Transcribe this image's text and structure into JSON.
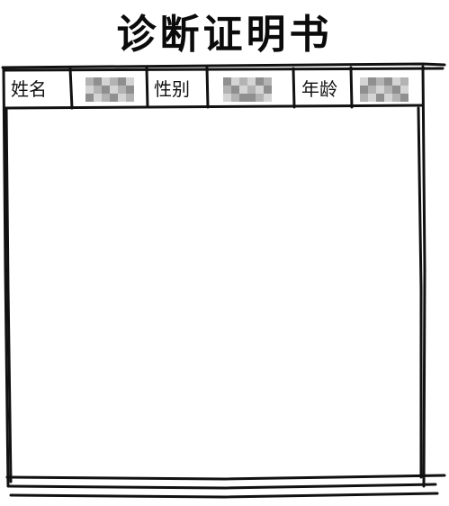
{
  "document": {
    "title": "诊断证明书"
  },
  "header_row": {
    "name_label": "姓名",
    "gender_label": "性别",
    "age_label": "年龄"
  },
  "redacted_fields": [
    {
      "field": "name",
      "state": "pixelated"
    },
    {
      "field": "gender",
      "state": "pixelated"
    },
    {
      "field": "age",
      "state": "pixelated"
    }
  ],
  "colors": {
    "ink": "#111111",
    "mosaic_light": "#d4d4d4",
    "mosaic_mid": "#b3b3b3",
    "mosaic_dark": "#8f8f8f"
  }
}
